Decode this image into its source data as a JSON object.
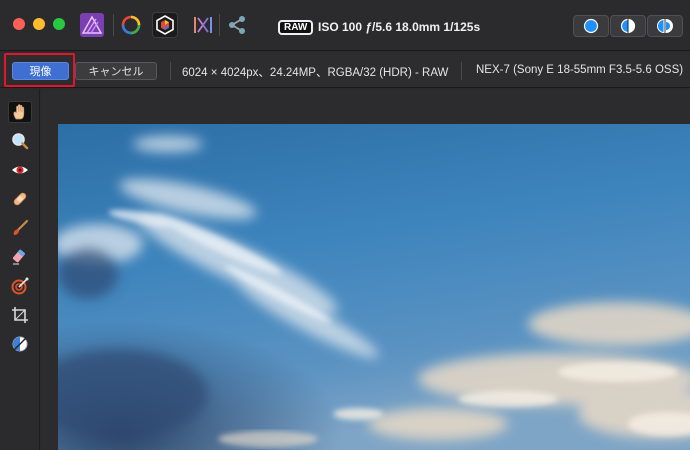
{
  "titlebar": {
    "raw_badge": "RAW",
    "exif": "ISO 100 ƒ/5.6 18.0mm 1/125s",
    "personas": [
      {
        "icon": "affinity-photo-icon"
      },
      {
        "icon": "color-wheel-icon"
      },
      {
        "icon": "develop-persona-icon"
      },
      {
        "icon": "tone-mapping-icon"
      },
      {
        "icon": "share-icon"
      }
    ],
    "view_modes": [
      "single-view-icon",
      "split-view-icon",
      "mirror-view-icon"
    ]
  },
  "context_toolbar": {
    "develop_label": "現像",
    "cancel_label": "キャンセル",
    "image_info": "6024 × 4024px、24.24MP、RGBA/32 (HDR) - RAW",
    "camera_info": "NEX-7 (Sony E 18-55mm F3.5-5.6 OSS)"
  },
  "tools": [
    {
      "icon": "hand-tool-icon",
      "active": true
    },
    {
      "icon": "zoom-tool-icon"
    },
    {
      "icon": "red-eye-tool-icon"
    },
    {
      "icon": "blemish-removal-tool-icon"
    },
    {
      "icon": "overlay-paint-tool-icon"
    },
    {
      "icon": "overlay-erase-tool-icon"
    },
    {
      "icon": "overlay-gradient-tool-icon"
    },
    {
      "icon": "crop-tool-icon"
    },
    {
      "icon": "white-balance-tool-icon"
    }
  ],
  "colors": {
    "accent": "#3f6fd1",
    "highlight": "#e0162b",
    "background": "#2a2a2c"
  }
}
